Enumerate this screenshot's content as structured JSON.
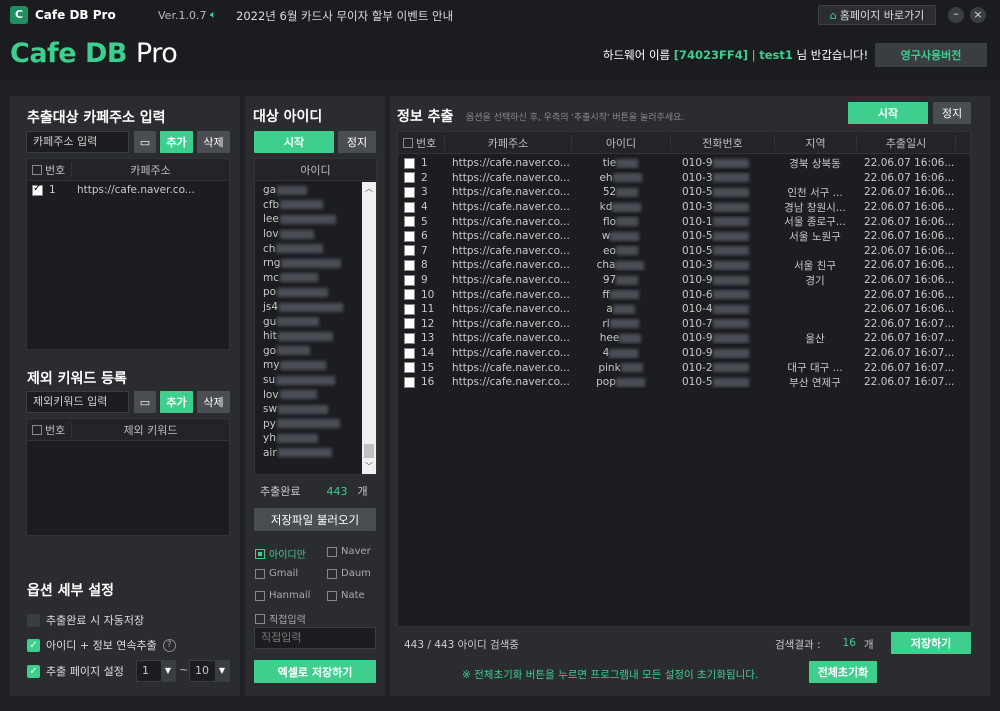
{
  "app": {
    "title": "Cafe DB Pro",
    "version": "Ver.1.0.7",
    "notice": "2022년 6월 카드사 무이자 할부 이벤트 안내",
    "homepage": "홈페이지 바로가기"
  },
  "header": {
    "brand_a": "Cafe DB",
    "brand_b": "Pro",
    "hw_label": "하드웨어 이름",
    "hw_id": "[74023FF4]",
    "sep": "|",
    "user": "test1",
    "greet": "님 반갑습니다!",
    "license": "영구사용버전"
  },
  "left": {
    "cafe_title": "추출대상 카페주소 입력",
    "cafe_placeholder": "카페주소 입력",
    "add": "추가",
    "del": "삭제",
    "col_no": "번호",
    "col_url": "카페주소",
    "cafe_rows": [
      {
        "no": "1",
        "url": "https://cafe.naver.co..."
      }
    ],
    "kw_title": "제외 키워드 등록",
    "kw_placeholder": "제외키워드 입력",
    "kw_col_kw": "제외 키워드",
    "opt_title": "옵션 세부 설정",
    "opt1": "추출완료 시 자동저장",
    "opt2": "아이디 + 정보 연속추출",
    "opt3": "추출 페이지 설정",
    "page_from": "1",
    "page_to": "10",
    "tilde": "~"
  },
  "mid": {
    "title": "대상 아이디",
    "start": "시작",
    "stop": "정지",
    "col_id": "아이디",
    "ids": [
      "ga",
      "cfb",
      "lee",
      "lov",
      "ch",
      "rng",
      "mc",
      "po",
      "js4",
      "gu",
      "hit",
      "go",
      "my",
      "su",
      "lov",
      "sw",
      "py",
      "yh",
      "air"
    ],
    "done_label": "추출완료",
    "done_count": "443",
    "unit": "개",
    "load": "저장파일 불러오기",
    "radio_id": "아이디만",
    "naver": "Naver",
    "gmail": "Gmail",
    "daum": "Daum",
    "hanmail": "Hanmail",
    "nate": "Nate",
    "direct": "직접입력",
    "direct_placeholder": "직접입력",
    "excel": "엑셀로 저장하기"
  },
  "right": {
    "title": "정보 추출",
    "hint": "옵션을 선택하신 후, 우측의 '추출시작' 버튼을 눌러주세요.",
    "start": "시작",
    "stop": "정지",
    "cols": [
      "번호",
      "카페주소",
      "아이디",
      "전화번호",
      "지역",
      "추출일시"
    ],
    "rows": [
      {
        "no": "1",
        "url": "https://cafe.naver.co...",
        "id": "tie",
        "phone": "010-9",
        "region": "경북 상북동",
        "date": "22.06.07 16:06..."
      },
      {
        "no": "2",
        "url": "https://cafe.naver.co...",
        "id": "eh",
        "phone": "010-3",
        "region": "",
        "date": "22.06.07 16:06..."
      },
      {
        "no": "3",
        "url": "https://cafe.naver.co...",
        "id": "52",
        "phone": "010-5",
        "region": "인천 서구 ...",
        "date": "22.06.07 16:06..."
      },
      {
        "no": "4",
        "url": "https://cafe.naver.co...",
        "id": "kd",
        "phone": "010-3",
        "region": "경남 창원시...",
        "date": "22.06.07 16:06..."
      },
      {
        "no": "5",
        "url": "https://cafe.naver.co...",
        "id": "flo",
        "phone": "010-1",
        "region": "서울 종로구...",
        "date": "22.06.07 16:06..."
      },
      {
        "no": "6",
        "url": "https://cafe.naver.co...",
        "id": "w",
        "phone": "010-5",
        "region": "서울 노원구",
        "date": "22.06.07 16:06..."
      },
      {
        "no": "7",
        "url": "https://cafe.naver.co...",
        "id": "eo",
        "phone": "010-5",
        "region": "",
        "date": "22.06.07 16:06..."
      },
      {
        "no": "8",
        "url": "https://cafe.naver.co...",
        "id": "cha",
        "phone": "010-3",
        "region": "서울 친구",
        "date": "22.06.07 16:06..."
      },
      {
        "no": "9",
        "url": "https://cafe.naver.co...",
        "id": "97",
        "phone": "010-9",
        "region": "경기",
        "date": "22.06.07 16:06..."
      },
      {
        "no": "10",
        "url": "https://cafe.naver.co...",
        "id": "ff",
        "phone": "010-6",
        "region": "",
        "date": "22.06.07 16:06..."
      },
      {
        "no": "11",
        "url": "https://cafe.naver.co...",
        "id": "a",
        "phone": "010-4",
        "region": "",
        "date": "22.06.07 16:06..."
      },
      {
        "no": "12",
        "url": "https://cafe.naver.co...",
        "id": "rl",
        "phone": "010-7",
        "region": "",
        "date": "22.06.07 16:07..."
      },
      {
        "no": "13",
        "url": "https://cafe.naver.co...",
        "id": "hee",
        "phone": "010-9",
        "region": "울산",
        "date": "22.06.07 16:07..."
      },
      {
        "no": "14",
        "url": "https://cafe.naver.co...",
        "id": "4",
        "phone": "010-9",
        "region": "",
        "date": "22.06.07 16:07..."
      },
      {
        "no": "15",
        "url": "https://cafe.naver.co...",
        "id": "pink",
        "phone": "010-2",
        "region": "대구 대구 ...",
        "date": "22.06.07 16:07..."
      },
      {
        "no": "16",
        "url": "https://cafe.naver.co...",
        "id": "pop",
        "phone": "010-5",
        "region": "부산 연제구",
        "date": "22.06.07 16:07..."
      }
    ],
    "status": "443 / 443 아이디 검색중",
    "result_label": "검색결과 :",
    "result_count": "16",
    "unit": "개",
    "save": "저장하기",
    "reset_note": "※ 전체초기화 버튼을 누르면 프로그램내 모든 설정이 초기화됩니다.",
    "reset": "전체초기화"
  },
  "colors": {
    "accent": "#3ecf8e",
    "hw_id": "#3ecf8e",
    "bg": "#1e2023"
  }
}
